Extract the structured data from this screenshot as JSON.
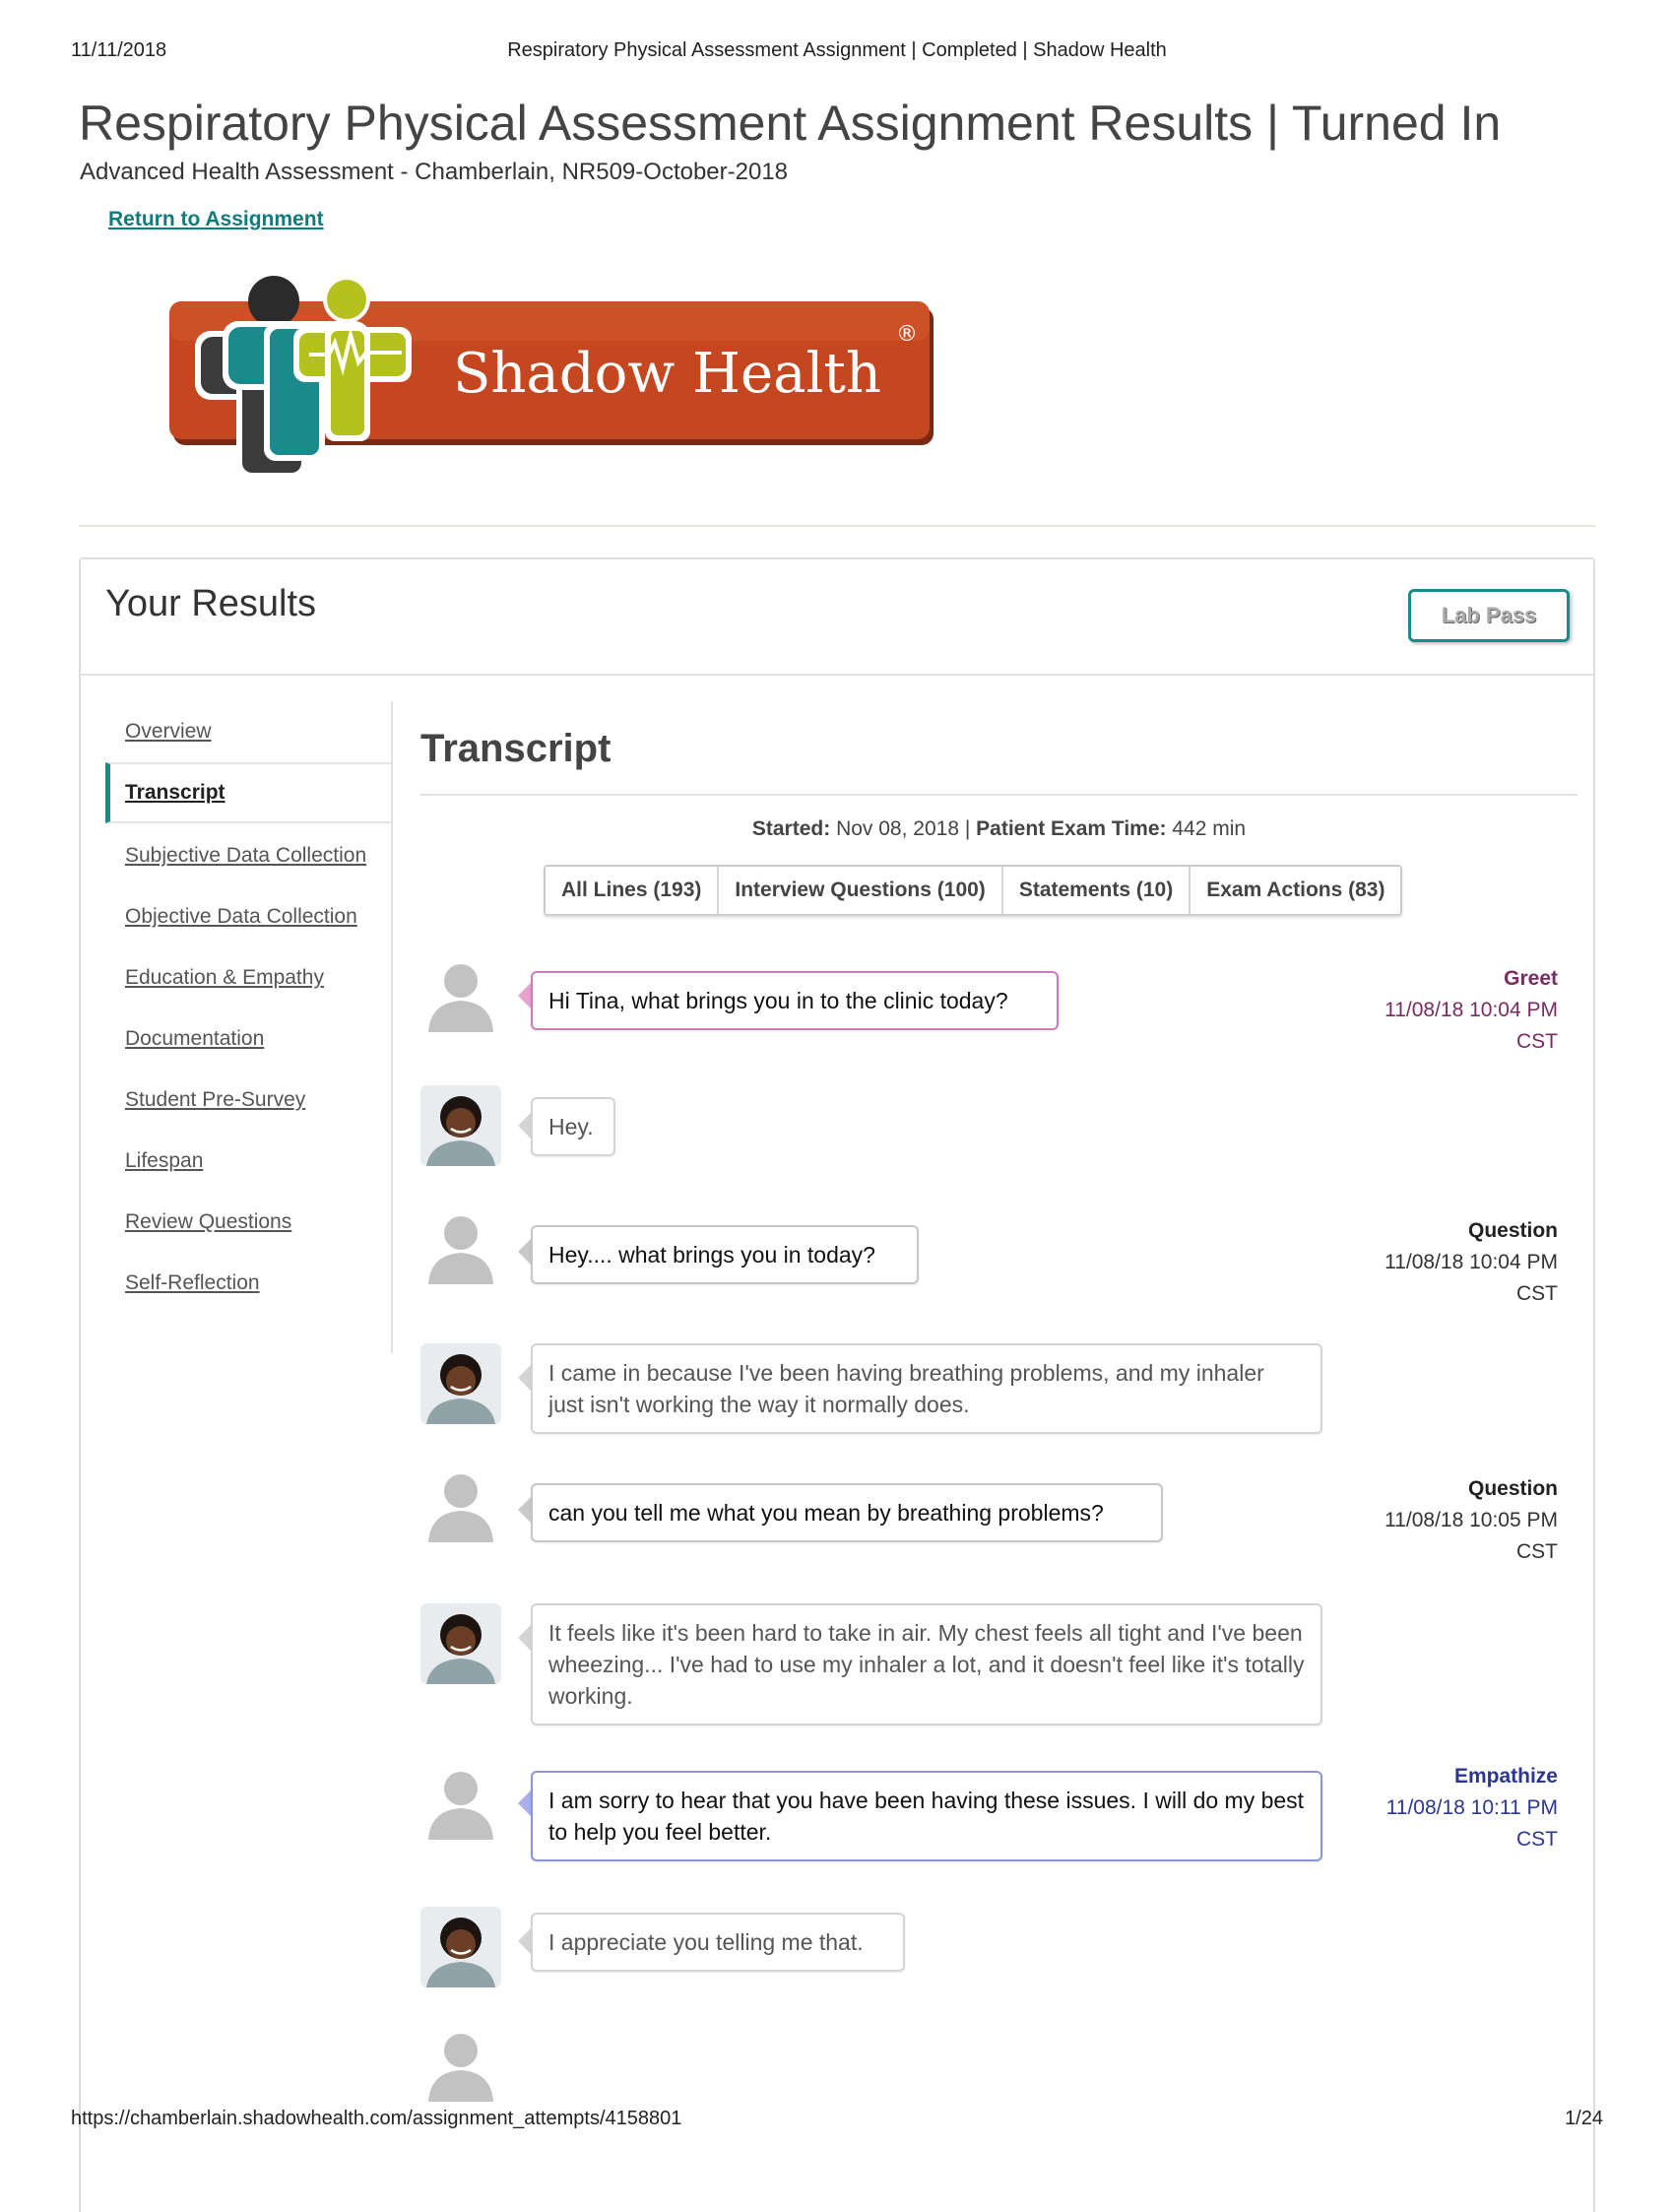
{
  "print": {
    "date": "11/11/2018",
    "title": "Respiratory Physical Assessment Assignment | Completed | Shadow Health",
    "url": "https://chamberlain.shadowhealth.com/assignment_attempts/4158801",
    "page": "1/24"
  },
  "header": {
    "title": "Respiratory Physical Assessment Assignment Results | Turned In",
    "course": "Advanced Health Assessment - Chamberlain, NR509-October-2018",
    "return_link": "Return to Assignment"
  },
  "logo": {
    "text": "Shadow Health",
    "registered": "®"
  },
  "results": {
    "title": "Your Results",
    "lab_pass": "Lab Pass"
  },
  "sidebar": {
    "items": [
      {
        "label": "Overview"
      },
      {
        "label": "Transcript",
        "active": true
      },
      {
        "label": "Subjective Data Collection"
      },
      {
        "label": "Objective Data Collection"
      },
      {
        "label": "Education & Empathy"
      },
      {
        "label": "Documentation"
      },
      {
        "label": "Student Pre-Survey"
      },
      {
        "label": "Lifespan"
      },
      {
        "label": "Review Questions"
      },
      {
        "label": "Self-Reflection"
      }
    ]
  },
  "transcript": {
    "title": "Transcript",
    "started_label": "Started:",
    "started_value": "Nov 08, 2018",
    "separator": "|",
    "exam_time_label": "Patient Exam Time:",
    "exam_time_value": "442",
    "exam_time_unit": "min",
    "filters": [
      {
        "label": "All Lines (193)"
      },
      {
        "label": "Interview Questions (100)"
      },
      {
        "label": "Statements (10)"
      },
      {
        "label": "Exam Actions (83)"
      }
    ],
    "lines": [
      {
        "speaker": "student",
        "text": "Hi Tina, what brings you in to the clinic today?",
        "category": "Greet",
        "time": "11/08/18 10:04 PM",
        "zone": "CST"
      },
      {
        "speaker": "patient",
        "text": "Hey."
      },
      {
        "speaker": "student",
        "text": "Hey.... what brings you in today?",
        "category": "Question",
        "time": "11/08/18 10:04 PM",
        "zone": "CST"
      },
      {
        "speaker": "patient",
        "text": "I came in because I've been having breathing problems, and my inhaler just isn't working the way it normally does."
      },
      {
        "speaker": "student",
        "text": "can you tell me what you mean by breathing problems?",
        "category": "Question",
        "time": "11/08/18 10:05 PM",
        "zone": "CST"
      },
      {
        "speaker": "patient",
        "text": "It feels like it's been hard to take in air. My chest feels all tight and I've been wheezing... I've had to use my inhaler a lot, and it doesn't feel like it's totally working."
      },
      {
        "speaker": "student",
        "text": "I am sorry to hear that you have been having these issues. I will do my best to help you feel better.",
        "category": "Empathize",
        "time": "11/08/18 10:11 PM",
        "zone": "CST"
      },
      {
        "speaker": "patient",
        "text": "I appreciate you telling me that."
      },
      {
        "speaker": "student",
        "text": ""
      }
    ]
  },
  "colors": {
    "teal": "#1a8a8c",
    "greet": "#7b2a63",
    "empathize": "#2c3790",
    "logo_orange": "#c5471f",
    "logo_lime": "#b5c21d"
  }
}
